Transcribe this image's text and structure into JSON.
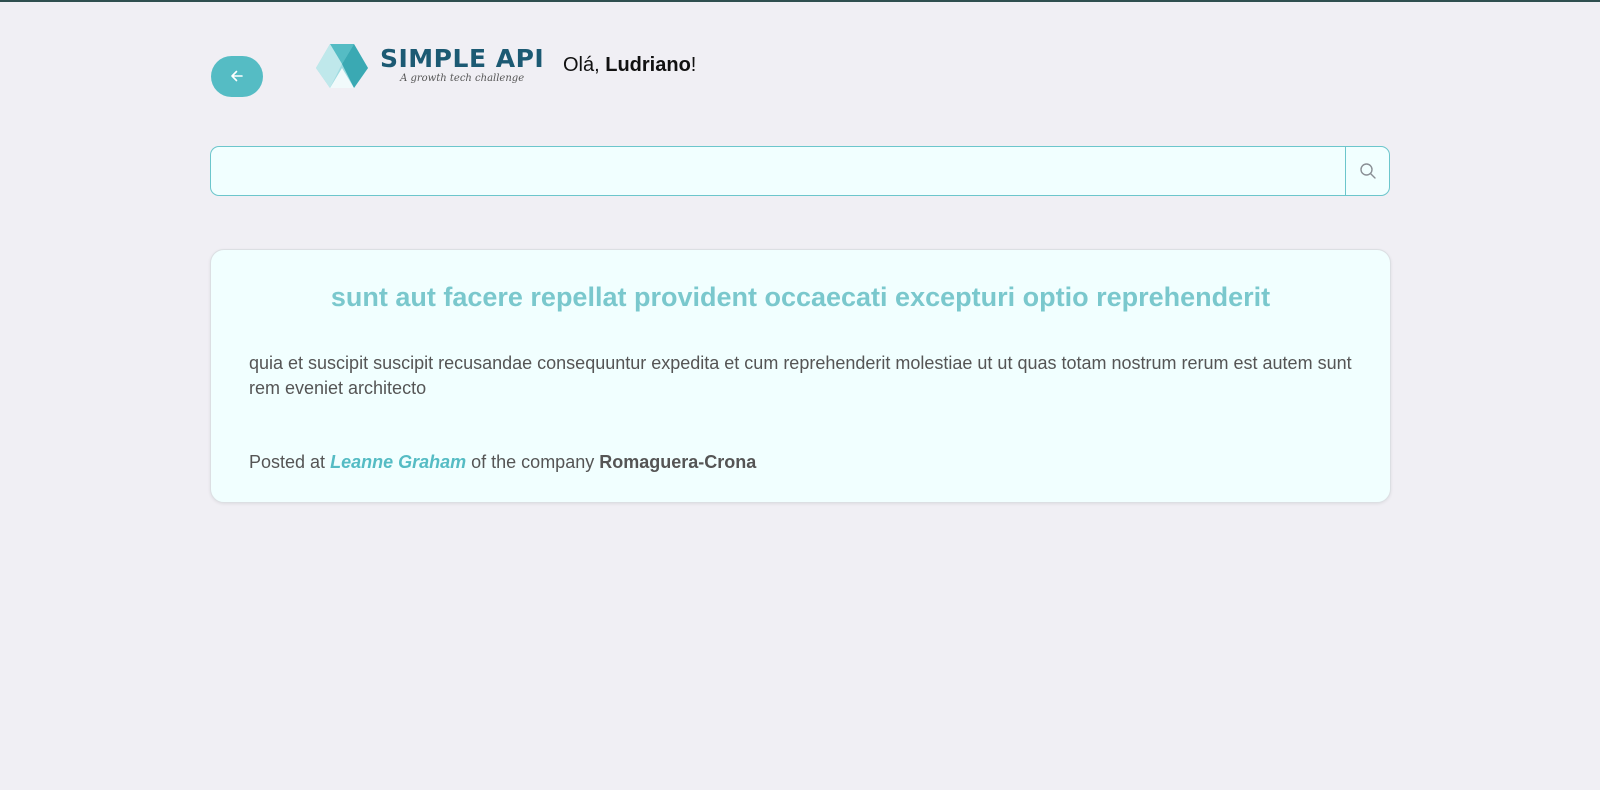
{
  "header": {
    "logo": {
      "title": "SIMPLE API",
      "tagline": "A growth tech challenge"
    },
    "greeting": {
      "prefix": "Olá, ",
      "user_name": "Ludriano",
      "suffix": "!"
    }
  },
  "search": {
    "value": "",
    "placeholder": ""
  },
  "post": {
    "title": "sunt aut facere repellat provident occaecati excepturi optio reprehenderit",
    "body": "quia et suscipit suscipit recusandae consequuntur expedita et cum reprehenderit molestiae ut ut quas totam nostrum rerum est autem sunt rem eveniet architecto",
    "meta": {
      "posted_prefix": "Posted at",
      "author": "Leanne Graham",
      "company_prefix": "of the company",
      "company": "Romaguera-Crona"
    }
  },
  "icons": {
    "back": "arrow-left-icon",
    "search": "search-icon",
    "logo": "triangle-logo-icon"
  },
  "colors": {
    "accent": "#55bcc4",
    "title": "#7ac8cd",
    "brand": "#1c5a73",
    "background": "#f0eff4",
    "card": "#f1ffff"
  }
}
